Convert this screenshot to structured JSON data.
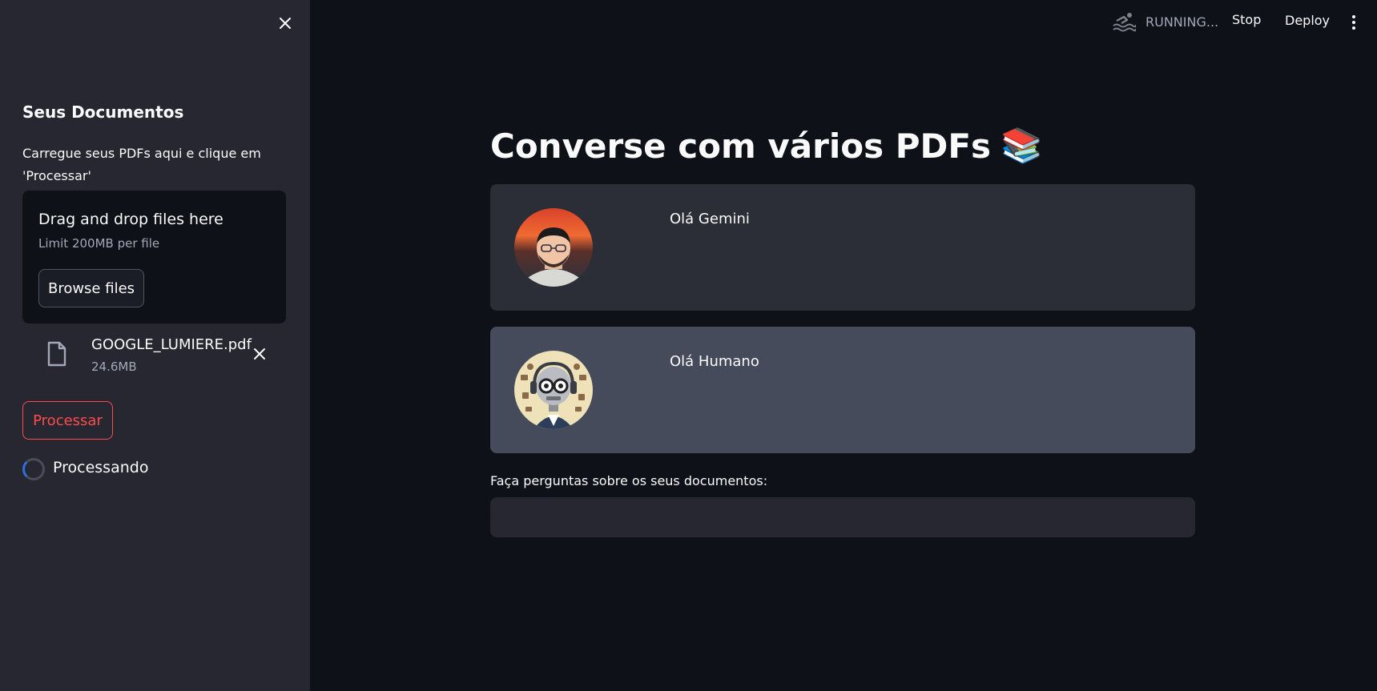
{
  "sidebar": {
    "title": "Seus Documentos",
    "description": "Carregue seus PDFs aqui e clique em 'Processar'",
    "uploader": {
      "title": "Drag and drop files here",
      "limit": "Limit 200MB per file",
      "browse_label": "Browse files"
    },
    "file": {
      "name": "GOOGLE_LUMIERE.pdf",
      "size": "24.6MB",
      "icon": "file-icon"
    },
    "process_label": "Processar",
    "processing_label": "Processando"
  },
  "header": {
    "status": "RUNNING...",
    "status_icon": "swimmer-icon",
    "stop_label": "Stop",
    "deploy_label": "Deploy"
  },
  "main": {
    "title": "Converse com vários PDFs",
    "title_icon": "📚",
    "messages": [
      {
        "role": "user",
        "text": "Olá Gemini",
        "avatar": "user-photo"
      },
      {
        "role": "bot",
        "text": "Olá Humano",
        "avatar": "robot-illustration"
      }
    ],
    "question_label": "Faça perguntas sobre os seus documentos:",
    "question_value": ""
  },
  "colors": {
    "background": "#0e1117",
    "sidebar": "#262730",
    "accent": "#ff4b4b",
    "user_card": "#2b2d37",
    "bot_card": "#464b5c"
  }
}
